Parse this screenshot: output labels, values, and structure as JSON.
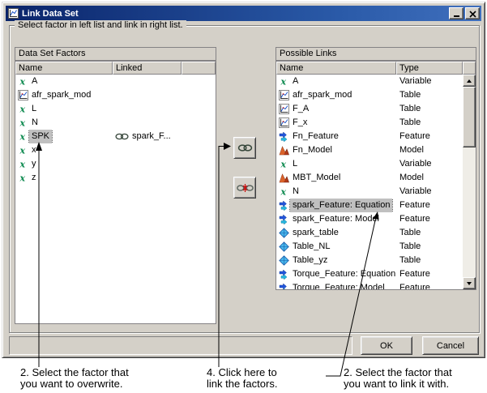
{
  "window": {
    "title": "Link Data Set"
  },
  "groupbox": {
    "label": "Select factor in left list and link in right list."
  },
  "left_panel": {
    "title": "Data Set Factors",
    "columns": [
      "Name",
      "Linked"
    ],
    "rows": [
      {
        "icon": "variable",
        "name": "A",
        "linked": "",
        "link_icon": false,
        "selected": false
      },
      {
        "icon": "table-plot",
        "name": "afr_spark_mod",
        "linked": "",
        "link_icon": false,
        "selected": false
      },
      {
        "icon": "variable",
        "name": "L",
        "linked": "",
        "link_icon": false,
        "selected": false
      },
      {
        "icon": "variable",
        "name": "N",
        "linked": "",
        "link_icon": false,
        "selected": false
      },
      {
        "icon": "variable",
        "name": "SPK",
        "linked": "spark_F...",
        "link_icon": true,
        "selected": true
      },
      {
        "icon": "variable",
        "name": "x",
        "linked": "",
        "link_icon": false,
        "selected": false
      },
      {
        "icon": "variable",
        "name": "y",
        "linked": "",
        "link_icon": false,
        "selected": false
      },
      {
        "icon": "variable",
        "name": "z",
        "linked": "",
        "link_icon": false,
        "selected": false
      }
    ]
  },
  "right_panel": {
    "title": "Possible Links",
    "columns": [
      "Name",
      "Type"
    ],
    "rows": [
      {
        "icon": "variable",
        "name": "A",
        "type": "Variable",
        "selected": false
      },
      {
        "icon": "table-plot",
        "name": "afr_spark_mod",
        "type": "Table",
        "selected": false
      },
      {
        "icon": "table-plot",
        "name": "F_A",
        "type": "Table",
        "selected": false
      },
      {
        "icon": "table-plot",
        "name": "F_x",
        "type": "Table",
        "selected": false
      },
      {
        "icon": "feature",
        "name": "Fn_Feature",
        "type": "Feature",
        "selected": false
      },
      {
        "icon": "model",
        "name": "Fn_Model",
        "type": "Model",
        "selected": false
      },
      {
        "icon": "variable",
        "name": "L",
        "type": "Variable",
        "selected": false
      },
      {
        "icon": "model",
        "name": "MBT_Model",
        "type": "Model",
        "selected": false
      },
      {
        "icon": "variable",
        "name": "N",
        "type": "Variable",
        "selected": false
      },
      {
        "icon": "feature",
        "name": "spark_Feature: Equation",
        "type": "Feature",
        "selected": true
      },
      {
        "icon": "feature",
        "name": "spark_Feature: Model",
        "type": "Feature",
        "selected": false
      },
      {
        "icon": "table3d",
        "name": "spark_table",
        "type": "Table",
        "selected": false
      },
      {
        "icon": "table3d",
        "name": "Table_NL",
        "type": "Table",
        "selected": false
      },
      {
        "icon": "table3d",
        "name": "Table_yz",
        "type": "Table",
        "selected": false
      },
      {
        "icon": "feature",
        "name": "Torque_Feature: Equation",
        "type": "Feature",
        "selected": false
      },
      {
        "icon": "feature",
        "name": "Torque_Feature: Model",
        "type": "Feature",
        "selected": false
      }
    ]
  },
  "buttons": {
    "ok": "OK",
    "cancel": "Cancel"
  },
  "annotations": {
    "overwrite": {
      "line1": "2. Select the factor that",
      "line2": "you want to overwrite."
    },
    "link_here": {
      "line1": "4. Click here to",
      "line2": "link the factors."
    },
    "link_with": {
      "line1": "2. Select the factor that",
      "line2": "you want to link it with."
    }
  },
  "colors": {
    "titlebar": "#0a246a",
    "dialog_gray": "#d4d0c8",
    "selection": "#c0c0c0",
    "variable_green": "#0d8a4f"
  }
}
